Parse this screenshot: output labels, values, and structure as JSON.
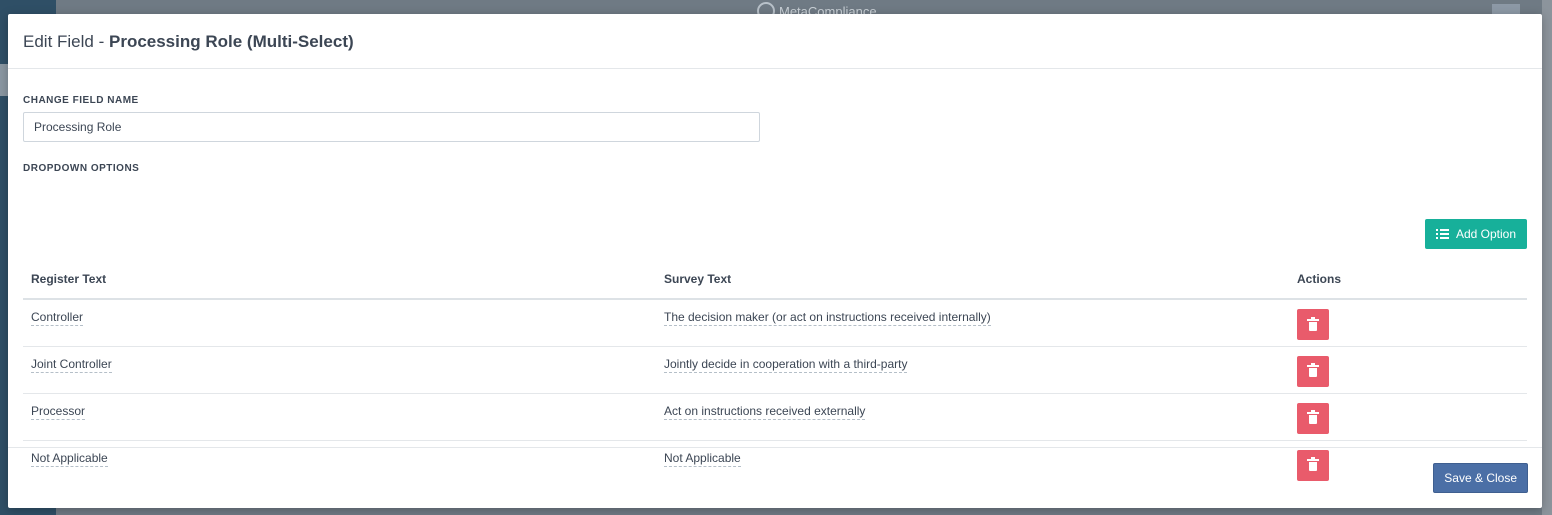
{
  "background": {
    "brand_name": "MetaCompliance"
  },
  "modal": {
    "title_prefix": "Edit Field - ",
    "title_field": "Processing Role (Multi-Select)",
    "field_name_label": "CHANGE FIELD NAME",
    "field_name_value": "Processing Role",
    "dropdown_label": "DROPDOWN OPTIONS",
    "add_option_label": "Add Option",
    "table": {
      "headers": [
        "Register Text",
        "Survey Text",
        "Actions"
      ],
      "rows": [
        {
          "register": "Controller",
          "survey": "The decision maker (or act on instructions received internally)"
        },
        {
          "register": "Joint Controller",
          "survey": "Jointly decide in cooperation with a third-party"
        },
        {
          "register": "Processor",
          "survey": "Act on instructions received externally"
        },
        {
          "register": "Not Applicable",
          "survey": "Not Applicable"
        }
      ]
    },
    "save_label": "Save & Close"
  },
  "colors": {
    "add_button": "#17b09a",
    "delete_button": "#e95b6b",
    "save_button": "#4b6fa6"
  }
}
